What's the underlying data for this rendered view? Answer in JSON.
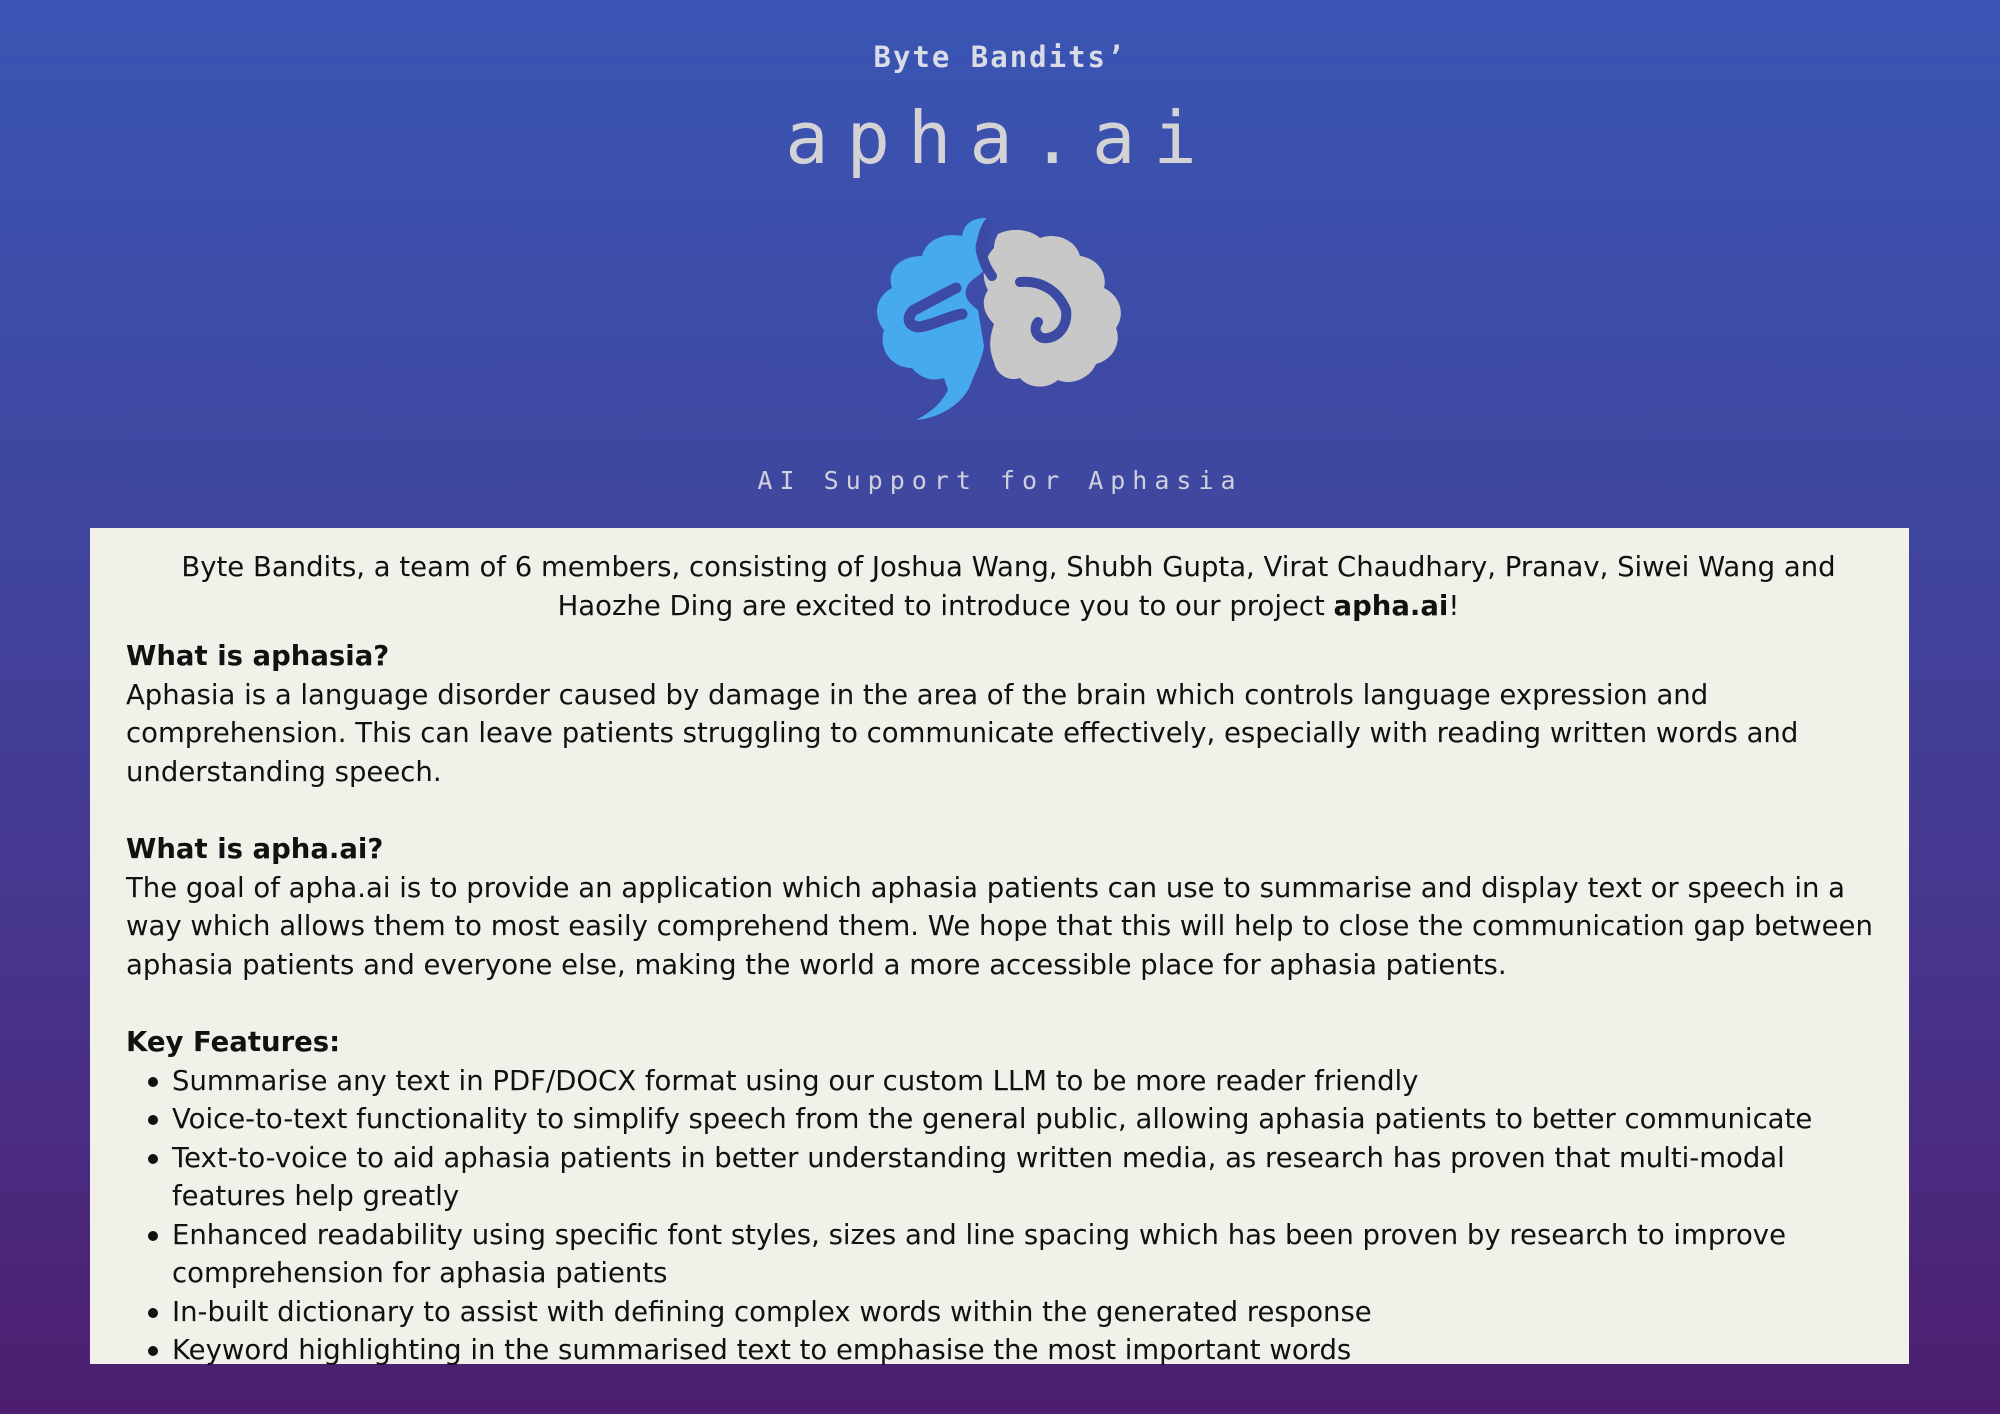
{
  "header": {
    "team_name": "Byte Bandits’",
    "app_title": "apha.ai",
    "logo_icon": "brain-icon",
    "tagline": "AI Support for Aphasia"
  },
  "colors": {
    "background_top": "#3a55b4",
    "background_bottom": "#4d1e6e",
    "card_background": "#f1f1e9",
    "brain_left": "#47a9ee",
    "brain_right": "#c8c8c8"
  },
  "intro": {
    "text": "Byte Bandits, a team of 6 members, consisting of Joshua Wang, Shubh Gupta, Virat Chaudhary, Pranav, Siwei Wang and Haozhe Ding are excited to introduce you to our project ",
    "project_name": "apha.ai",
    "suffix": "!"
  },
  "sections": {
    "aphasia": {
      "title": "What is aphasia?",
      "body": "Aphasia is a language disorder caused by damage in the area of the brain which controls language expression and comprehension. This can leave patients struggling to communicate effectively, especially with reading written words and understanding speech."
    },
    "aphaai": {
      "title": "What is apha.ai?",
      "body": "The goal of apha.ai is to provide an application which aphasia patients can use to summarise and display text or speech in a way which allows them to most easily comprehend them. We hope that this will help to close the communication gap between aphasia patients and everyone else, making the world a more accessible place for aphasia patients."
    },
    "features": {
      "title": "Key Features:",
      "items": [
        "Summarise any text in PDF/DOCX format using our custom LLM to be more reader friendly",
        "Voice-to-text functionality to simplify speech from the general public, allowing aphasia patients to better communicate",
        "Text-to-voice to aid aphasia patients in better understanding written media, as research has proven that multi-modal features help greatly",
        "Enhanced readability using specific font styles, sizes and line spacing which has been proven by research to improve comprehension for aphasia patients",
        "In-built dictionary to assist with defining complex words within the generated response",
        "Keyword highlighting in the summarised text to emphasise the most important words"
      ]
    }
  }
}
